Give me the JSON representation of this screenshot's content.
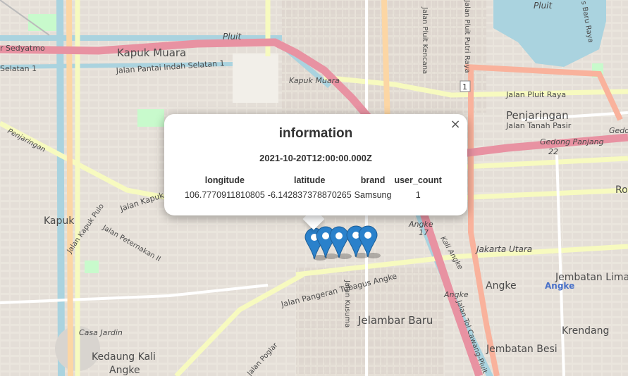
{
  "popup": {
    "title": "information",
    "date": "2021-10-20T12:00:00.000Z",
    "columns": [
      "longitude",
      "latitude",
      "brand",
      "user_count"
    ],
    "row": [
      "106.7770911810805",
      "-6.142837378870265",
      "Samsung",
      "1"
    ],
    "close_symbol": "×"
  },
  "map_labels": {
    "kapuk_muara": "Kapuk Muara",
    "pluit": "Pluit",
    "pluit_water": "Pluit",
    "jalan_pantai_indah": "Jalan Pantai Indah Selatan 1",
    "sedyatmo": "r Sedyatmo",
    "selatan1": "Selatan 1",
    "kapuk_muara_toll": "Kapuk Muara",
    "jalan_pluit_raya": "Jalan Pluit Raya",
    "penjaringan": "Penjaringan",
    "jalan_tanah_pasir": "Jalan Tanah Pasir",
    "gedong_panjang": "Gedong Panjang",
    "gedong_panjang_num": "22",
    "gedo": "Gedo",
    "ro": "Ro",
    "kapuk": "Kapuk",
    "jalan_kapuk_raya": "Jalan Kapuk Raya",
    "jalan_kapuk_pulo": "Jalan Kapuk Pulo",
    "jalan_peternakan": "Jalan Peternakan II",
    "penjaringan_west": "Penjaringan",
    "jalan_pangeran": "Jalan Pangeran Tubagus Angke",
    "jalan_kusuma": "Jalan Kusuma",
    "jelambar_baru": "Jelambar Baru",
    "angke": "Angke",
    "angke_blue": "Angke",
    "angke_num": "17",
    "angke_toll": "Angke",
    "jakarta_utara": "Jakarta Utara",
    "jembatan_lima": "Jembatan Lima",
    "krendang": "Krendang",
    "jembatan_besi": "Jembatan Besi",
    "casa_jardin": "Casa Jardin",
    "kedaung_kali": "Kedaung Kali",
    "angke_bottom": "Angke",
    "jalan_pluit_kencana": "Jalan Pluit Kencana",
    "jalan_pluit_putri": "Jalan Pluit Putri Raya",
    "jalan_tol_cawang": "Jalan Tol Cawang-Pluit",
    "kali_angke": "Kali Angke",
    "baru_raya": "s Baru Raya",
    "route_shield": "1",
    "jalan_poglar": "Jalan Poglar"
  },
  "colors": {
    "land": "#f2efe9",
    "water": "#aad3df",
    "motorway": "#e892a2",
    "trunk": "#f9b29c",
    "primary": "#fcd6a4",
    "secondary": "#f7fabf",
    "park": "#c8facc",
    "marker": "#2a81cb"
  },
  "markers": [
    {
      "icon": "map-pin-icon"
    },
    {
      "icon": "map-pin-icon"
    },
    {
      "icon": "map-pin-icon"
    },
    {
      "icon": "map-pin-icon"
    },
    {
      "icon": "map-pin-icon"
    }
  ]
}
